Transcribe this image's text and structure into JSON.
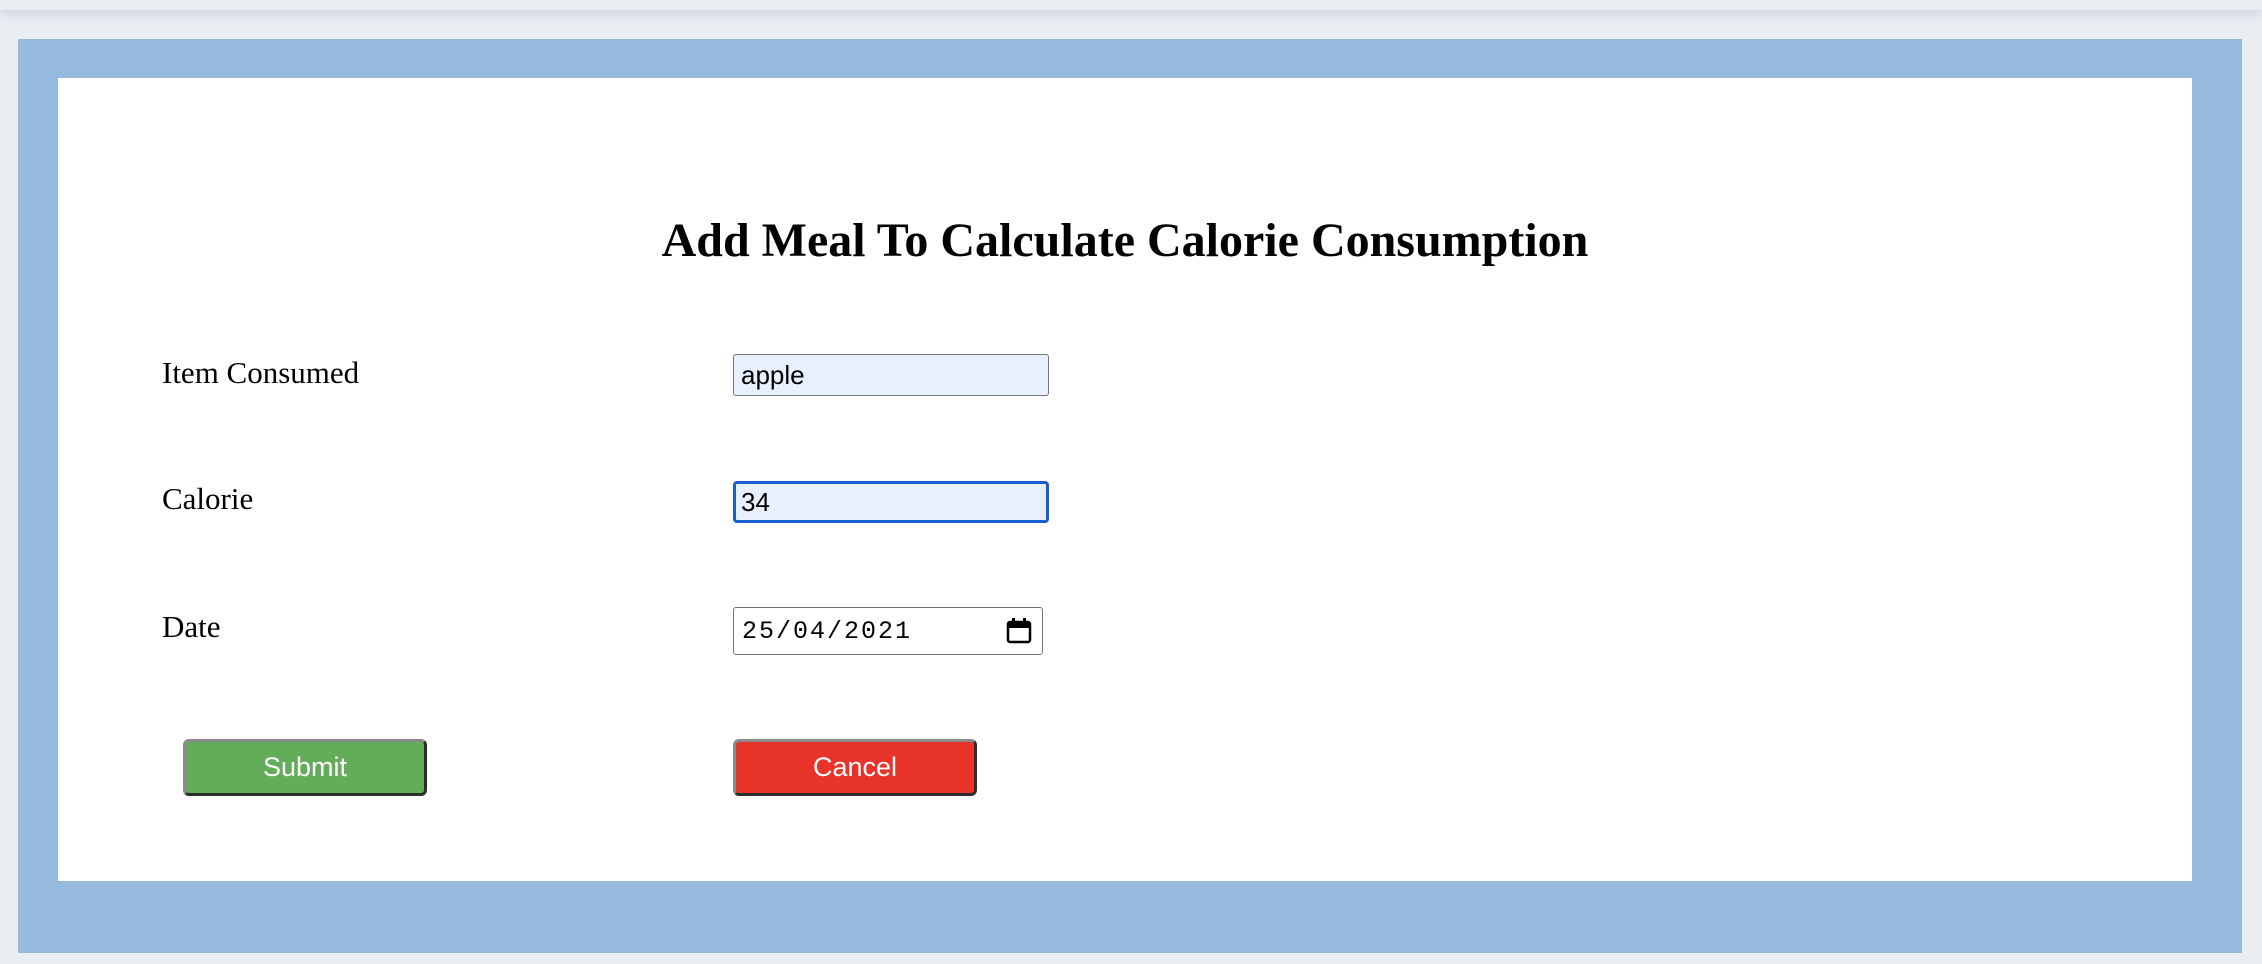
{
  "form": {
    "title": "Add Meal To Calculate Calorie Consumption",
    "item_label": "Item Consumed",
    "item_value": "apple",
    "calorie_label": "Calorie",
    "calorie_value": "34",
    "date_label": "Date",
    "date_value": "25/04/2021",
    "submit_label": "Submit",
    "cancel_label": "Cancel"
  },
  "colors": {
    "frame": "#95bade",
    "submit": "#63ac5a",
    "cancel": "#e7332a",
    "focus_border": "#1a5fd0",
    "autofill_bg": "#e8f0fe"
  },
  "icons": {
    "date_picker": "calendar-icon"
  }
}
